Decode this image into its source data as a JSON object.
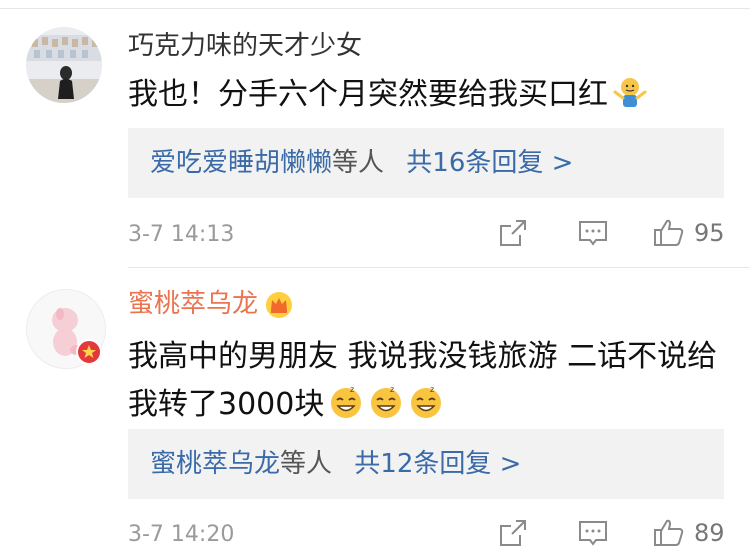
{
  "comments": [
    {
      "username": "巧克力味的天才少女",
      "text": "我也！分手六个月突然要给我买口红",
      "replies": {
        "names": "爱吃爱睡胡懒懒",
        "suffix": "等人",
        "count_text": "共16条回复 >"
      },
      "time": "3-7 14:13",
      "likes": "95",
      "emoji": "shrug-emoji"
    },
    {
      "username": "蜜桃萃乌龙",
      "text": "我高中的男朋友 我说我没钱旅游 二话不说给我转了3000块",
      "replies": {
        "names": "蜜桃萃乌龙",
        "suffix": "等人",
        "count_text": "共12条回复 >"
      },
      "time": "3-7 14:20",
      "likes": "89",
      "emoji": "sleepy-grin-emoji"
    }
  ],
  "colors": {
    "link": "#3a6aa7",
    "vip_name": "#eb7350",
    "reply_bg": "#f2f2f2",
    "meta": "#9a9a9a"
  }
}
